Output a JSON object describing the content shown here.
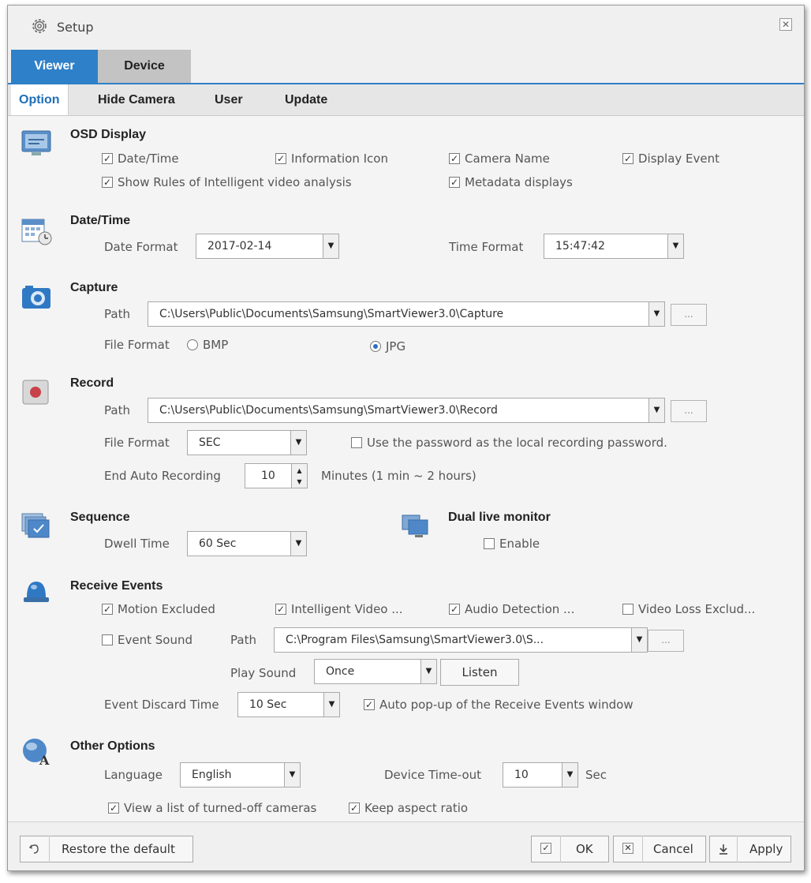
{
  "window": {
    "title": "Setup",
    "close_glyph": "✕"
  },
  "tabs_main": [
    {
      "label": "Viewer",
      "active": true
    },
    {
      "label": "Device",
      "active": false
    }
  ],
  "tabs_sub": [
    {
      "label": "Option",
      "active": true
    },
    {
      "label": "Hide Camera",
      "active": false
    },
    {
      "label": "User",
      "active": false
    },
    {
      "label": "Update",
      "active": false
    }
  ],
  "osd": {
    "title": "OSD Display",
    "date_time": "Date/Time",
    "information_icon": "Information Icon",
    "camera_name": "Camera Name",
    "display_event": "Display Event",
    "show_rules": "Show Rules of Intelligent video analysis",
    "metadata": "Metadata displays"
  },
  "datetime": {
    "title": "Date/Time",
    "date_format_label": "Date Format",
    "date_format_value": "2017-02-14",
    "time_format_label": "Time Format",
    "time_format_value": "15:47:42"
  },
  "capture": {
    "title": "Capture",
    "path_label": "Path",
    "path_value": "C:\\Users\\Public\\Documents\\Samsung\\SmartViewer3.0\\Capture",
    "file_format_label": "File Format",
    "bmp": "BMP",
    "jpg": "JPG",
    "selected": "JPG"
  },
  "record": {
    "title": "Record",
    "path_label": "Path",
    "path_value": "C:\\Users\\Public\\Documents\\Samsung\\SmartViewer3.0\\Record",
    "file_format_label": "File Format",
    "file_format_value": "SEC",
    "use_password": "Use the password as the local recording password.",
    "end_auto_label": "End Auto Recording",
    "end_auto_value": "10",
    "minutes_text": "Minutes (1 min ~ 2 hours)"
  },
  "sequence": {
    "title": "Sequence",
    "dwell_label": "Dwell Time",
    "dwell_value": "60 Sec"
  },
  "dual": {
    "title": "Dual live monitor",
    "enable": "Enable"
  },
  "events": {
    "title": "Receive Events",
    "motion": "Motion Excluded",
    "intelligent": "Intelligent Video ...",
    "audio": "Audio Detection ...",
    "video_loss": "Video Loss Exclud...",
    "event_sound": "Event Sound",
    "path_label": "Path",
    "path_value": "C:\\Program Files\\Samsung\\SmartViewer3.0\\S...",
    "play_sound_label": "Play Sound",
    "play_sound_value": "Once",
    "listen": "Listen",
    "discard_label": "Event Discard Time",
    "discard_value": "10 Sec",
    "auto_popup": "Auto pop-up of the Receive Events window"
  },
  "other": {
    "title": "Other Options",
    "language_label": "Language",
    "language_value": "English",
    "timeout_label": "Device Time-out",
    "timeout_value": "10",
    "timeout_unit": "Sec",
    "view_list": "View a list of turned-off cameras",
    "keep_aspect": "Keep aspect ratio"
  },
  "footer": {
    "restore": "Restore the default",
    "ok": "OK",
    "cancel": "Cancel",
    "apply": "Apply"
  },
  "glyphs": {
    "check": "✓",
    "ellipsis": "...",
    "arrow_down": "▼",
    "spin": "▲▼"
  },
  "colors": {
    "accent": "#2e80c8",
    "tab_inactive": "#c3c3c3"
  }
}
